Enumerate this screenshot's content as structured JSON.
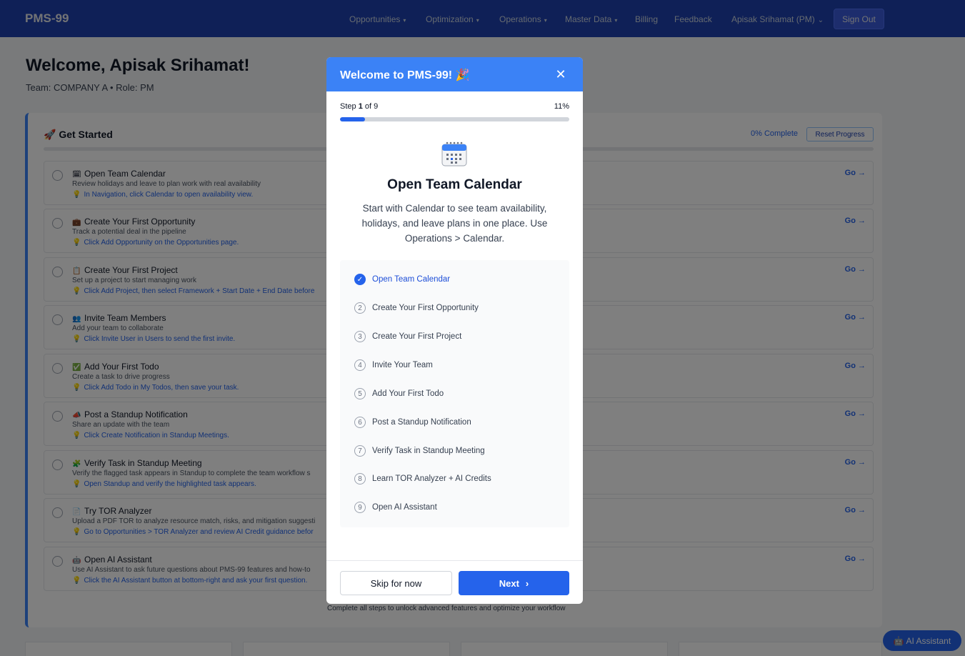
{
  "nav": {
    "brand": "PMS-99",
    "items": [
      {
        "label": "Opportunities",
        "dropdown": true
      },
      {
        "label": "Optimization",
        "dropdown": true
      },
      {
        "label": "Operations",
        "dropdown": true
      },
      {
        "label": "Master Data",
        "dropdown": true
      },
      {
        "label": "Billing",
        "dropdown": false
      },
      {
        "label": "Feedback",
        "dropdown": false
      }
    ],
    "user_menu": "Apisak Srihamat (PM)",
    "sign_out": "Sign Out"
  },
  "page": {
    "welcome": "Welcome, Apisak Srihamat!",
    "subtitle": "Team: COMPANY A • Role: PM"
  },
  "get_started": {
    "title": "🚀 Get Started",
    "progress_text": "0% Complete",
    "reset_label": "Reset Progress",
    "go_label": "Go →",
    "steps": [
      {
        "icon": "🗓",
        "title": "Open Team Calendar",
        "desc": "Review holidays and leave to plan work with real availability",
        "hint": "In Navigation, click Calendar to open availability view."
      },
      {
        "icon": "💼",
        "title": "Create Your First Opportunity",
        "desc": "Track a potential deal in the pipeline",
        "hint": "Click Add Opportunity on the Opportunities page."
      },
      {
        "icon": "📋",
        "title": "Create Your First Project",
        "desc": "Set up a project to start managing work",
        "hint": "Click Add Project, then select Framework + Start Date + End Date before"
      },
      {
        "icon": "👥",
        "title": "Invite Team Members",
        "desc": "Add your team to collaborate",
        "hint": "Click Invite User in Users to send the first invite."
      },
      {
        "icon": "✅",
        "title": "Add Your First Todo",
        "desc": "Create a task to drive progress",
        "hint": "Click Add Todo in My Todos, then save your task."
      },
      {
        "icon": "📣",
        "title": "Post a Standup Notification",
        "desc": "Share an update with the team",
        "hint": "Click Create Notification in Standup Meetings."
      },
      {
        "icon": "🧩",
        "title": "Verify Task in Standup Meeting",
        "desc": "Verify the flagged task appears in Standup to complete the team workflow s",
        "hint": "Open Standup and verify the highlighted task appears."
      },
      {
        "icon": "📄",
        "title": "Try TOR Analyzer",
        "desc": "Upload a PDF TOR to analyze resource match, risks, and mitigation suggesti",
        "hint": "Go to Opportunities > TOR Analyzer and review AI Credit guidance befor"
      },
      {
        "icon": "🤖",
        "title": "Open AI Assistant",
        "desc": "Use AI Assistant to ask future questions about PMS-99 features and how-to",
        "hint": "Click the AI Assistant button at bottom-right and ask your first question."
      }
    ],
    "footer_note": "Complete all steps to unlock advanced features and optimize your workflow"
  },
  "ai_button": "🤖 AI Assistant",
  "modal": {
    "title": "Welcome to PMS-99! 🎉",
    "step_prefix": "Step ",
    "step_current": "1",
    "step_suffix": " of 9",
    "percent_text": "11%",
    "progress_fraction": 0.11,
    "heading": "Open Team Calendar",
    "description": "Start with Calendar to see team availability, holidays, and leave plans in one place. Use Operations > Calendar.",
    "checklist": [
      {
        "num": "✓",
        "label": "Open Team Calendar",
        "done": true
      },
      {
        "num": "2",
        "label": "Create Your First Opportunity",
        "done": false
      },
      {
        "num": "3",
        "label": "Create Your First Project",
        "done": false
      },
      {
        "num": "4",
        "label": "Invite Your Team",
        "done": false
      },
      {
        "num": "5",
        "label": "Add Your First Todo",
        "done": false
      },
      {
        "num": "6",
        "label": "Post a Standup Notification",
        "done": false
      },
      {
        "num": "7",
        "label": "Verify Task in Standup Meeting",
        "done": false
      },
      {
        "num": "8",
        "label": "Learn TOR Analyzer + AI Credits",
        "done": false
      },
      {
        "num": "9",
        "label": "Open AI Assistant",
        "done": false
      }
    ],
    "skip_label": "Skip for now",
    "next_label": "Next",
    "close_glyph": "✕"
  }
}
